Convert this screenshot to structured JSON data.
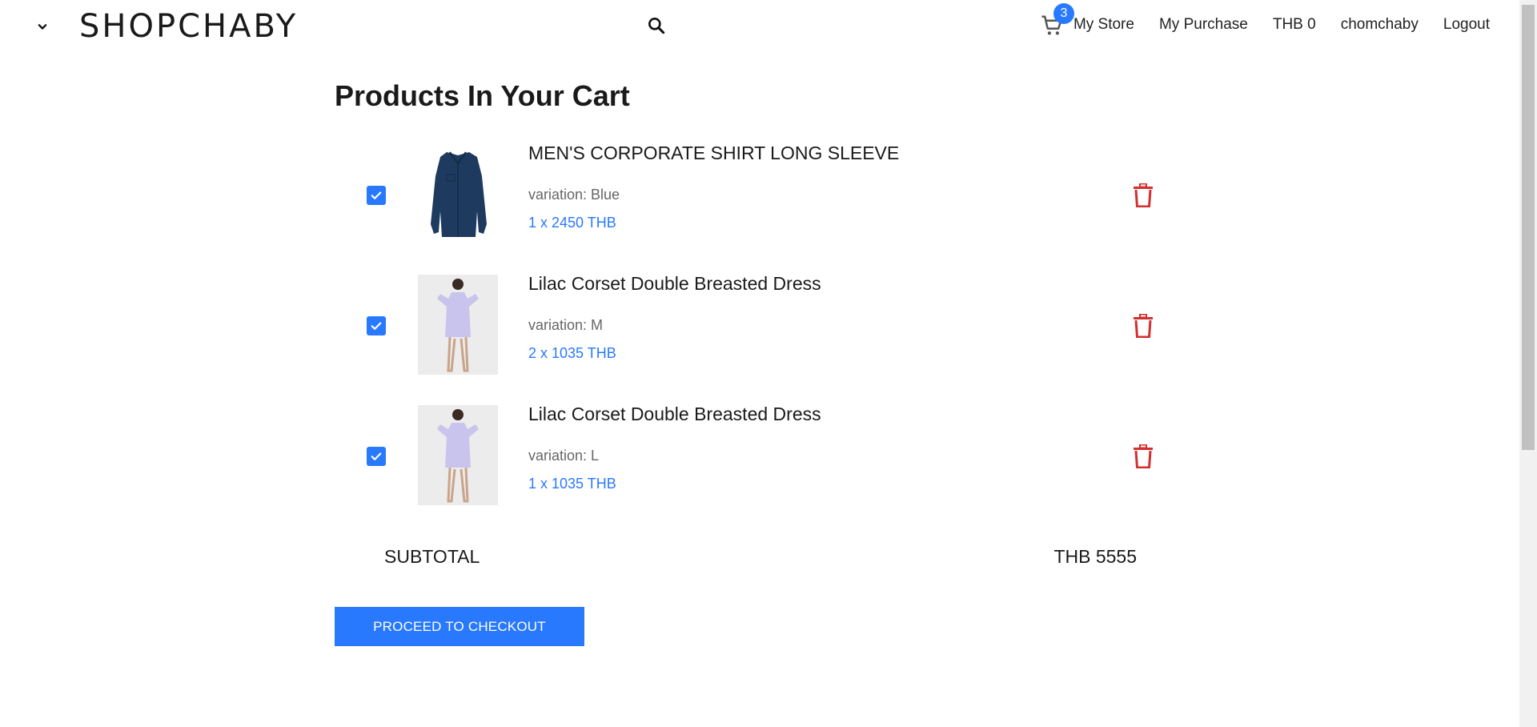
{
  "header": {
    "brand": "SHOPCHABY",
    "cart_count": "3",
    "nav": {
      "my_store": "My Store",
      "my_purchase": "My Purchase",
      "balance": "THB 0",
      "username": "chomchaby",
      "logout": "Logout"
    },
    "icons": {
      "menu": "chevron-down-icon",
      "search": "search-icon",
      "cart": "cart-icon"
    }
  },
  "main": {
    "title": "Products In Your Cart",
    "items": [
      {
        "name": "MEN'S CORPORATE SHIRT LONG SLEEVE",
        "variation": "variation: Blue",
        "price": "1 x 2450 THB",
        "checked": true
      },
      {
        "name": "Lilac Corset Double Breasted Dress",
        "variation": "variation: M",
        "price": "2 x 1035 THB",
        "checked": true
      },
      {
        "name": "Lilac Corset Double Breasted Dress",
        "variation": "variation: L",
        "price": "1 x 1035 THB",
        "checked": true
      }
    ],
    "subtotal_label": "SUBTOTAL",
    "subtotal_value": "THB 5555",
    "checkout_label": "PROCEED TO CHECKOUT"
  },
  "colors": {
    "accent": "#2979ff",
    "delete": "#d32f2f",
    "shirt": "#1f3a5f",
    "dress": "#c9c4ee"
  }
}
